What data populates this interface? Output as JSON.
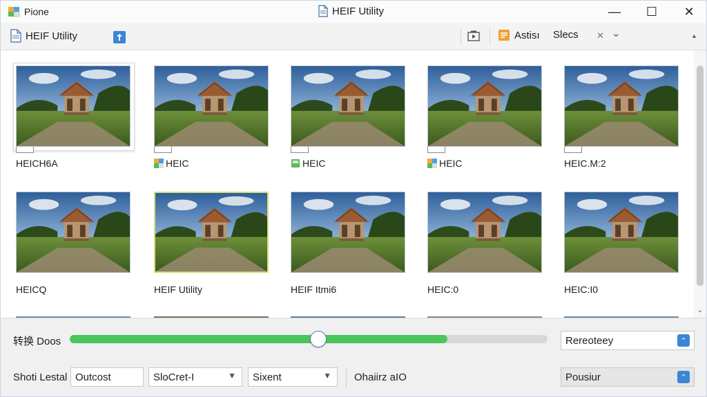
{
  "titlebar": {
    "app_name": "Pione",
    "title": "HEIF Utility",
    "minimize": "—",
    "maximize": "☐",
    "close": "✕"
  },
  "toolbar": {
    "left_label": "HEIF Utility",
    "assist_label": "Astisı",
    "slecs_label": "Slecs",
    "x_label": "✕",
    "chevron": "⌄",
    "scroll_up": "▲"
  },
  "thumbnails": [
    {
      "caption": "HEICH6A",
      "icon": "none",
      "selected": false,
      "focused": true
    },
    {
      "caption": "HEIC",
      "icon": "color-file-icon",
      "selected": false,
      "focused": false
    },
    {
      "caption": "HEIC",
      "icon": "green-file-icon",
      "selected": false,
      "focused": false
    },
    {
      "caption": "HEIC",
      "icon": "color-file-icon",
      "selected": false,
      "focused": false
    },
    {
      "caption": "HEIC.M:2",
      "icon": "none",
      "selected": false,
      "focused": false
    },
    {
      "caption": "HEICQ",
      "icon": "none",
      "selected": false,
      "focused": false
    },
    {
      "caption": "HEIF Utility",
      "icon": "none",
      "selected": true,
      "focused": false
    },
    {
      "caption": "HEIF Itmi6",
      "icon": "none",
      "selected": false,
      "focused": false
    },
    {
      "caption": "HEIC:0",
      "icon": "none",
      "selected": false,
      "focused": false
    },
    {
      "caption": "HEIC:I0",
      "icon": "none",
      "selected": false,
      "focused": false
    }
  ],
  "bottom": {
    "convert_label": "转换 Doos",
    "slider_fill_fraction": 0.79,
    "slider_knob_fraction": 0.52,
    "repository_value": "Rereoteey",
    "short_label": "Shoti Lestal",
    "output_value": "Outcost",
    "select_value": "SloCret-I",
    "extent_value": "Sixent",
    "options_label": "Ohaiirz aIO",
    "preview_value": "Pousiur",
    "up_glyph": "⌃",
    "down_glyph": "⌄"
  }
}
